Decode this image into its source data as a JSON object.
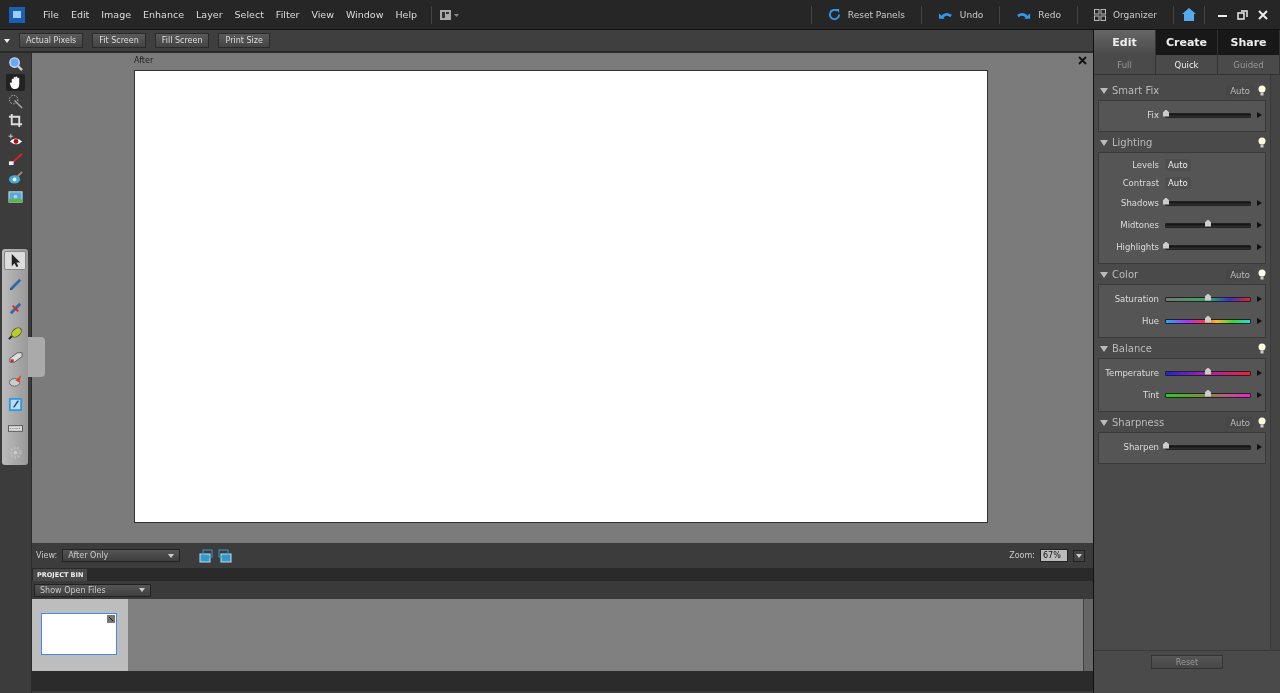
{
  "menu_bar": {
    "items": [
      "File",
      "Edit",
      "Image",
      "Enhance",
      "Layer",
      "Select",
      "Filter",
      "View",
      "Window",
      "Help"
    ],
    "actions": [
      {
        "kind": "reset",
        "label": "Reset Panels"
      },
      {
        "kind": "undo",
        "label": "Undo"
      },
      {
        "kind": "redo",
        "label": "Redo"
      },
      {
        "kind": "organizer",
        "label": "Organizer"
      }
    ]
  },
  "options_bar": {
    "buttons": [
      "Actual Pixels",
      "Fit Screen",
      "Fill Screen",
      "Print Size"
    ]
  },
  "tools": [
    {
      "kind": "zoom",
      "selected": false
    },
    {
      "kind": "hand",
      "selected": true
    },
    {
      "kind": "wand",
      "selected": false
    },
    {
      "kind": "crop",
      "selected": false
    },
    {
      "kind": "eye",
      "selected": false
    },
    {
      "kind": "toothbrush",
      "selected": false
    },
    {
      "kind": "eyebrush",
      "selected": false
    },
    {
      "kind": "image",
      "selected": false
    }
  ],
  "secondary_tools": [
    {
      "kind": "pointer",
      "selected": true
    },
    {
      "kind": "pen",
      "selected": false
    },
    {
      "kind": "pen2",
      "selected": false
    },
    {
      "kind": "marker",
      "selected": false
    },
    {
      "kind": "eraser",
      "selected": false
    },
    {
      "kind": "brush",
      "selected": false
    },
    {
      "kind": "note",
      "selected": false
    },
    {
      "kind": "keyboard",
      "selected": false
    },
    {
      "kind": "gear",
      "selected": false
    }
  ],
  "document": {
    "label": "After"
  },
  "view_bar": {
    "label": "View:",
    "view": "After Only",
    "zoom_label": "Zoom:",
    "zoom": "67%"
  },
  "project_bin": {
    "tab": "PROJECT BIN",
    "filter": "Show Open Files",
    "thumbnails": [
      {
        "selected": true
      }
    ]
  },
  "panel": {
    "tabs": [
      {
        "label": "Edit",
        "selected": true
      },
      {
        "label": "Create",
        "selected": false
      },
      {
        "label": "Share",
        "selected": false
      }
    ],
    "subtabs": [
      {
        "label": "Full",
        "selected": false
      },
      {
        "label": "Quick",
        "selected": true
      },
      {
        "label": "Guided",
        "selected": false
      }
    ],
    "sections": [
      {
        "title": "Smart Fix",
        "auto": "Auto",
        "controls": [
          {
            "kind": "slider",
            "label": "Fix",
            "level": 0
          }
        ]
      },
      {
        "title": "Lighting",
        "controls": [
          {
            "kind": "auto",
            "label": "Levels",
            "button": "Auto"
          },
          {
            "kind": "auto",
            "label": "Contrast",
            "button": "Auto"
          },
          {
            "kind": "slider",
            "label": "Shadows",
            "level": 0
          },
          {
            "kind": "slider",
            "label": "Midtones",
            "level": 0.5
          },
          {
            "kind": "slider",
            "label": "Highlights",
            "level": 0
          }
        ]
      },
      {
        "title": "Color",
        "auto": "Auto",
        "controls": [
          {
            "kind": "saturation",
            "label": "Saturation",
            "level": 0.5
          },
          {
            "kind": "hue",
            "label": "Hue",
            "level": 0.5
          }
        ]
      },
      {
        "title": "Balance",
        "controls": [
          {
            "kind": "temperature",
            "label": "Temperature",
            "level": 0.5
          },
          {
            "kind": "tint",
            "label": "Tint",
            "level": 0.5
          }
        ]
      },
      {
        "title": "Sharpness",
        "auto": "Auto",
        "controls": [
          {
            "kind": "slider",
            "label": "Sharpen",
            "level": 0
          }
        ]
      }
    ],
    "reset": "Reset"
  }
}
